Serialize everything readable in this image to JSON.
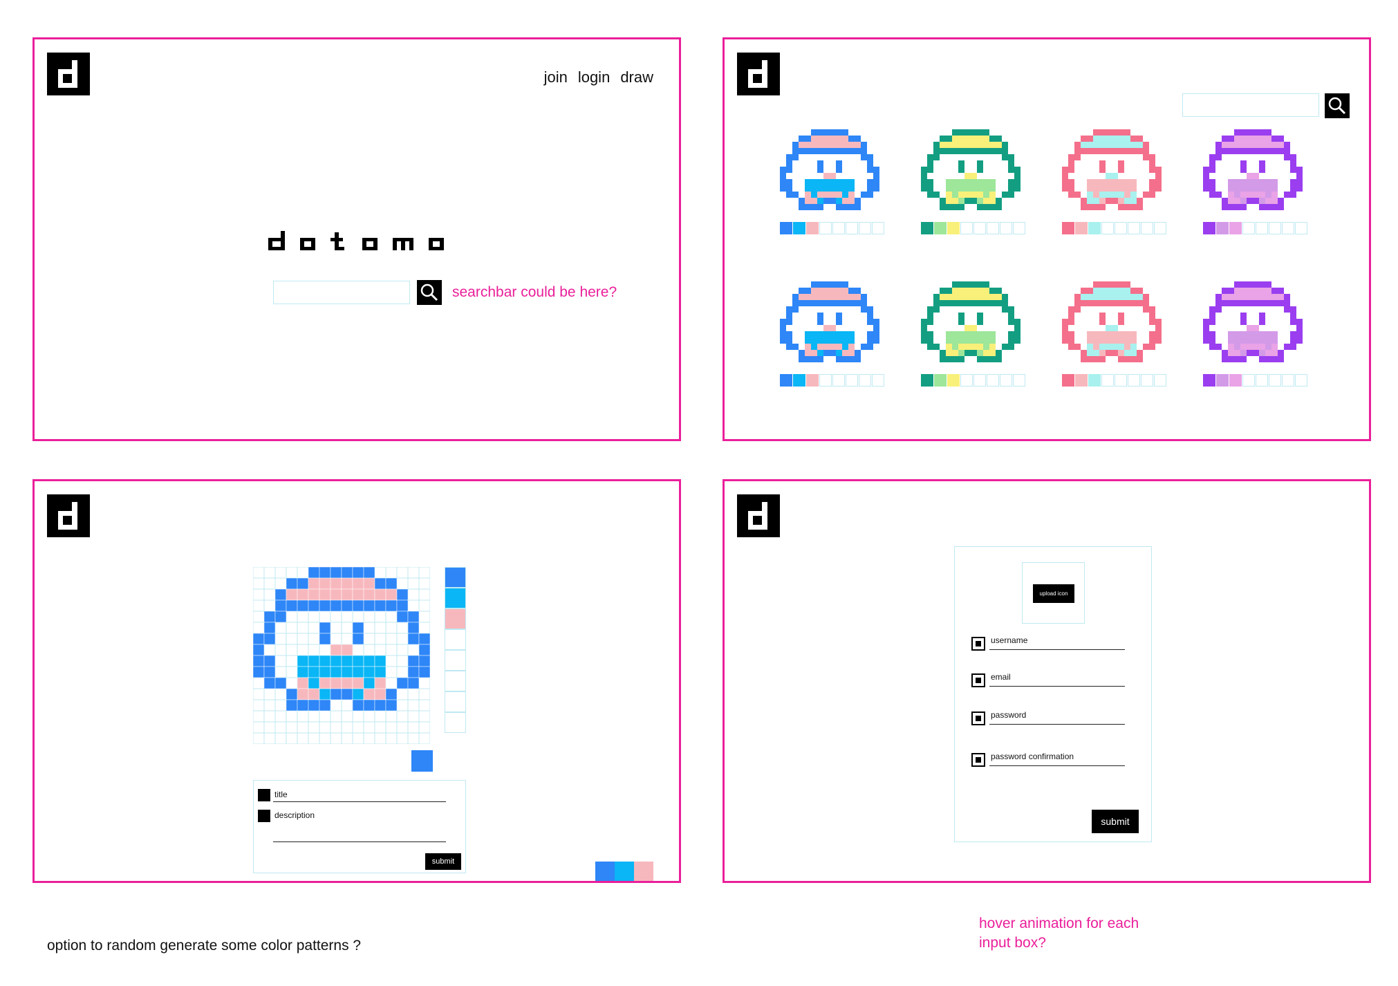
{
  "brand": {
    "logo_letter": "d",
    "wordmark": "dotomo"
  },
  "landing": {
    "nav": [
      "join",
      "login",
      "draw"
    ],
    "note": "searchbar could be here?"
  },
  "gallery": {
    "palettes": [
      [
        "#2e86f7",
        "#0ab6f5",
        "#f7b8bd"
      ],
      [
        "#139e82",
        "#9de69a",
        "#f9f07a"
      ],
      [
        "#f46f8b",
        "#f7b8bd",
        "#a8f1ef"
      ],
      [
        "#9a3ef0",
        "#d39ae8",
        "#e9a3e6"
      ]
    ]
  },
  "editor": {
    "palette": [
      "#2e86f7",
      "#0ab6f5",
      "#f7b8bd",
      "",
      "",
      "",
      "",
      ""
    ],
    "current_color": "#2e86f7",
    "title_label": "title",
    "description_label": "description",
    "submit_label": "submit",
    "random_palette": [
      "#2e86f7",
      "#0ab6f5",
      "#f7b8bd"
    ]
  },
  "signup": {
    "upload_label": "upload icon",
    "fields": [
      "username",
      "email",
      "password",
      "password confirmation"
    ],
    "submit_label": "submit"
  },
  "notes": {
    "random": "option to random generate some color patterns ?",
    "hover": "hover animation for each input box?"
  }
}
